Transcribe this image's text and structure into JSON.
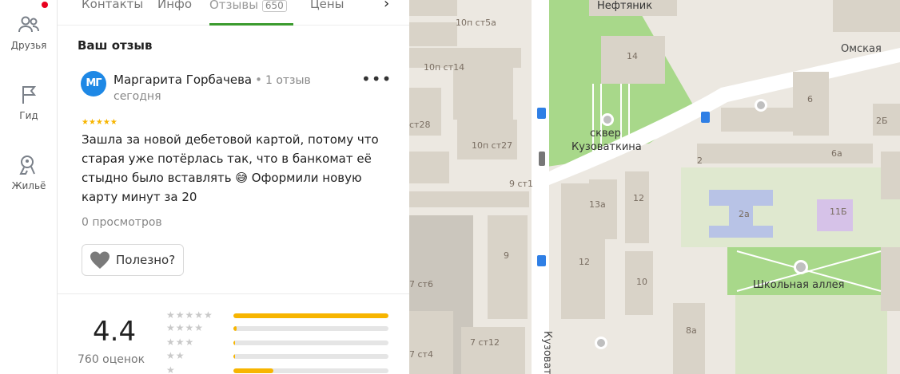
{
  "rail": {
    "friends_label": "Друзья",
    "guide_label": "Гид",
    "housing_label": "Жильё"
  },
  "tabs": {
    "contacts": "Контакты",
    "info": "Инфо",
    "reviews": "Отзывы",
    "reviews_count": "650",
    "prices": "Цены"
  },
  "review": {
    "section_title": "Ваш отзыв",
    "avatar_initials": "МГ",
    "author": "Маргарита Горбачева",
    "author_reviews": "1 отзыв",
    "date": "сегодня",
    "stars": "★★★★★",
    "text": "Зашла за новой дебетовой картой, потому что старая уже потёрлась так, что в банкомат её стыдно было вставлять 😅 Оформили новую карту минут за 20",
    "views": "0 просмотров",
    "useful_label": "Полезно?"
  },
  "rating": {
    "value": "4.4",
    "count_label": "760 оценок",
    "distribution": [
      {
        "stars": "★★★★★",
        "fraction": 1.0
      },
      {
        "stars": "★★★★",
        "fraction": 0.02
      },
      {
        "stars": "★★★",
        "fraction": 0.01
      },
      {
        "stars": "★★",
        "fraction": 0.01
      },
      {
        "stars": "★",
        "fraction": 0.26
      }
    ]
  },
  "map": {
    "labels": {
      "neftyanik": "Нефтяник",
      "n14": "14",
      "n10p_st5a": "10п ст5а",
      "n10p_st14": "10п ст14",
      "st28": "ст28",
      "n10p_st27": "10п ст27",
      "n9_st1": "9 ст1",
      "n6": "6",
      "n2b": "2Б",
      "n6a": "6а",
      "n2": "2",
      "n12": "12",
      "n13a": "13а",
      "n2a": "2а",
      "n11b": "11Б",
      "n9": "9",
      "n12b": "12",
      "n10": "10",
      "n7_st6": "7 ст6",
      "n7_st12": "7 ст12",
      "n7_st4": "7 ст4",
      "n8a": "8а"
    },
    "streets": {
      "omskaya": "Омская",
      "kuzovatkina": "Кузоватк"
    },
    "parks": {
      "skver_line1": "сквер",
      "skver_line2": "Кузоваткина",
      "school_alley": "Школьная аллея"
    }
  }
}
